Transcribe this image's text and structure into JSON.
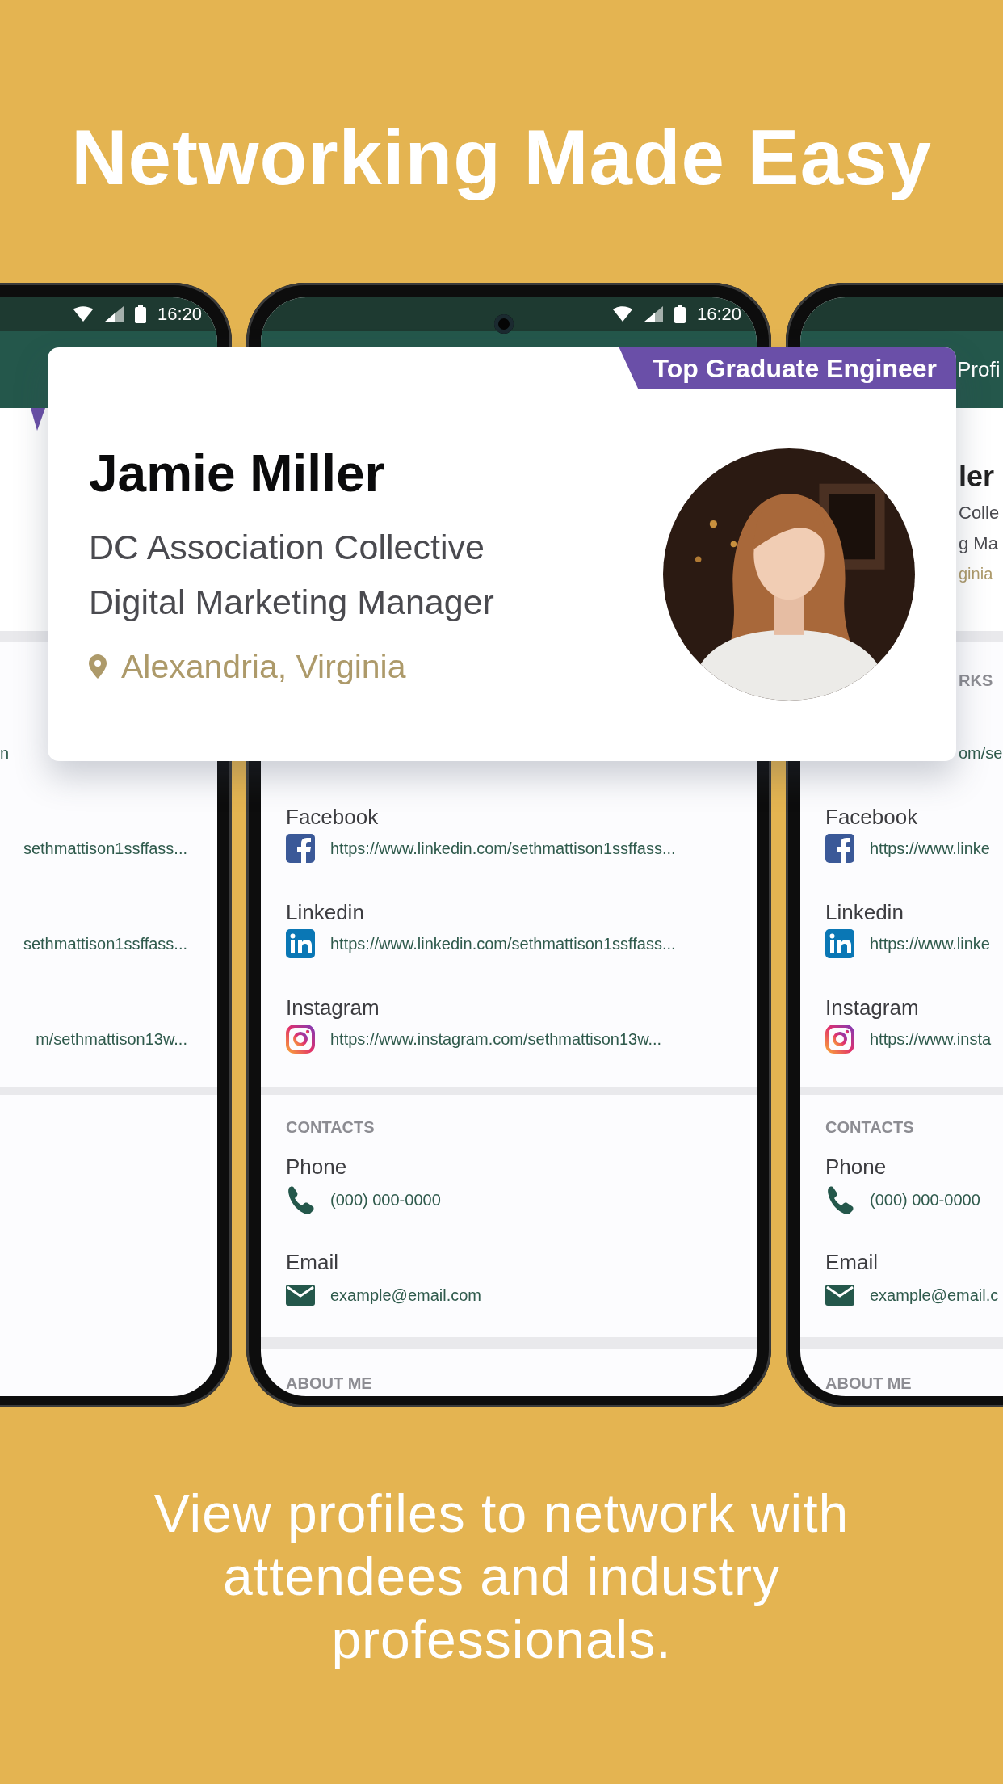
{
  "headline": "Networking Made Easy",
  "profile_card": {
    "badge": "Top Graduate Engineer",
    "name": "Jamie Miller",
    "organization": "DC Association Collective",
    "job_title": "Digital Marketing Manager",
    "location": "Alexandria, Virginia"
  },
  "left_phone": {
    "status_time": "16:20",
    "networks": [
      {
        "kind": "website",
        "url": "n"
      },
      {
        "kind": "facebook",
        "url": "sethmattison1ssffass..."
      },
      {
        "kind": "linkedin",
        "url": "sethmattison1ssffass..."
      },
      {
        "kind": "instagram",
        "url": "m/sethmattison13w..."
      }
    ]
  },
  "center_phone": {
    "status_time": "16:20",
    "networks": [
      {
        "kind": "facebook",
        "label": "Facebook",
        "url": "https://www.linkedin.com/sethmattison1ssffass..."
      },
      {
        "kind": "linkedin",
        "label": "Linkedin",
        "url": "https://www.linkedin.com/sethmattison1ssffass..."
      },
      {
        "kind": "instagram",
        "label": "Instagram",
        "url": "https://www.instagram.com/sethmattison13w..."
      }
    ],
    "contacts_heading": "CONTACTS",
    "contacts": [
      {
        "kind": "phone",
        "label": "Phone",
        "value": "(000) 000-0000"
      },
      {
        "kind": "email",
        "label": "Email",
        "value": "example@email.com"
      }
    ],
    "about_heading": "ABOUT ME"
  },
  "right_phone": {
    "app_bar_title": "Profi",
    "profile_fragments": [
      {
        "kind": "name",
        "text": "ler"
      },
      {
        "kind": "organization",
        "text": "Colle"
      },
      {
        "kind": "job_title",
        "text": "g Ma"
      },
      {
        "kind": "location",
        "text": "ginia"
      }
    ],
    "networks_heading": "RKS",
    "networks": [
      {
        "kind": "website",
        "url": "om/se"
      },
      {
        "kind": "facebook",
        "label": "Facebook",
        "url": "https://www.linke"
      },
      {
        "kind": "linkedin",
        "label": "Linkedin",
        "url": "https://www.linke"
      },
      {
        "kind": "instagram",
        "label": "Instagram",
        "url": "https://www.insta"
      }
    ],
    "contacts_heading": "CONTACTS",
    "contacts": [
      {
        "kind": "phone",
        "label": "Phone",
        "value": "(000) 000-0000"
      },
      {
        "kind": "email",
        "label": "Email",
        "value": "example@email.c"
      }
    ],
    "about_heading": "ABOUT ME"
  },
  "tagline": "View profiles to network with attendees and industry professionals."
}
